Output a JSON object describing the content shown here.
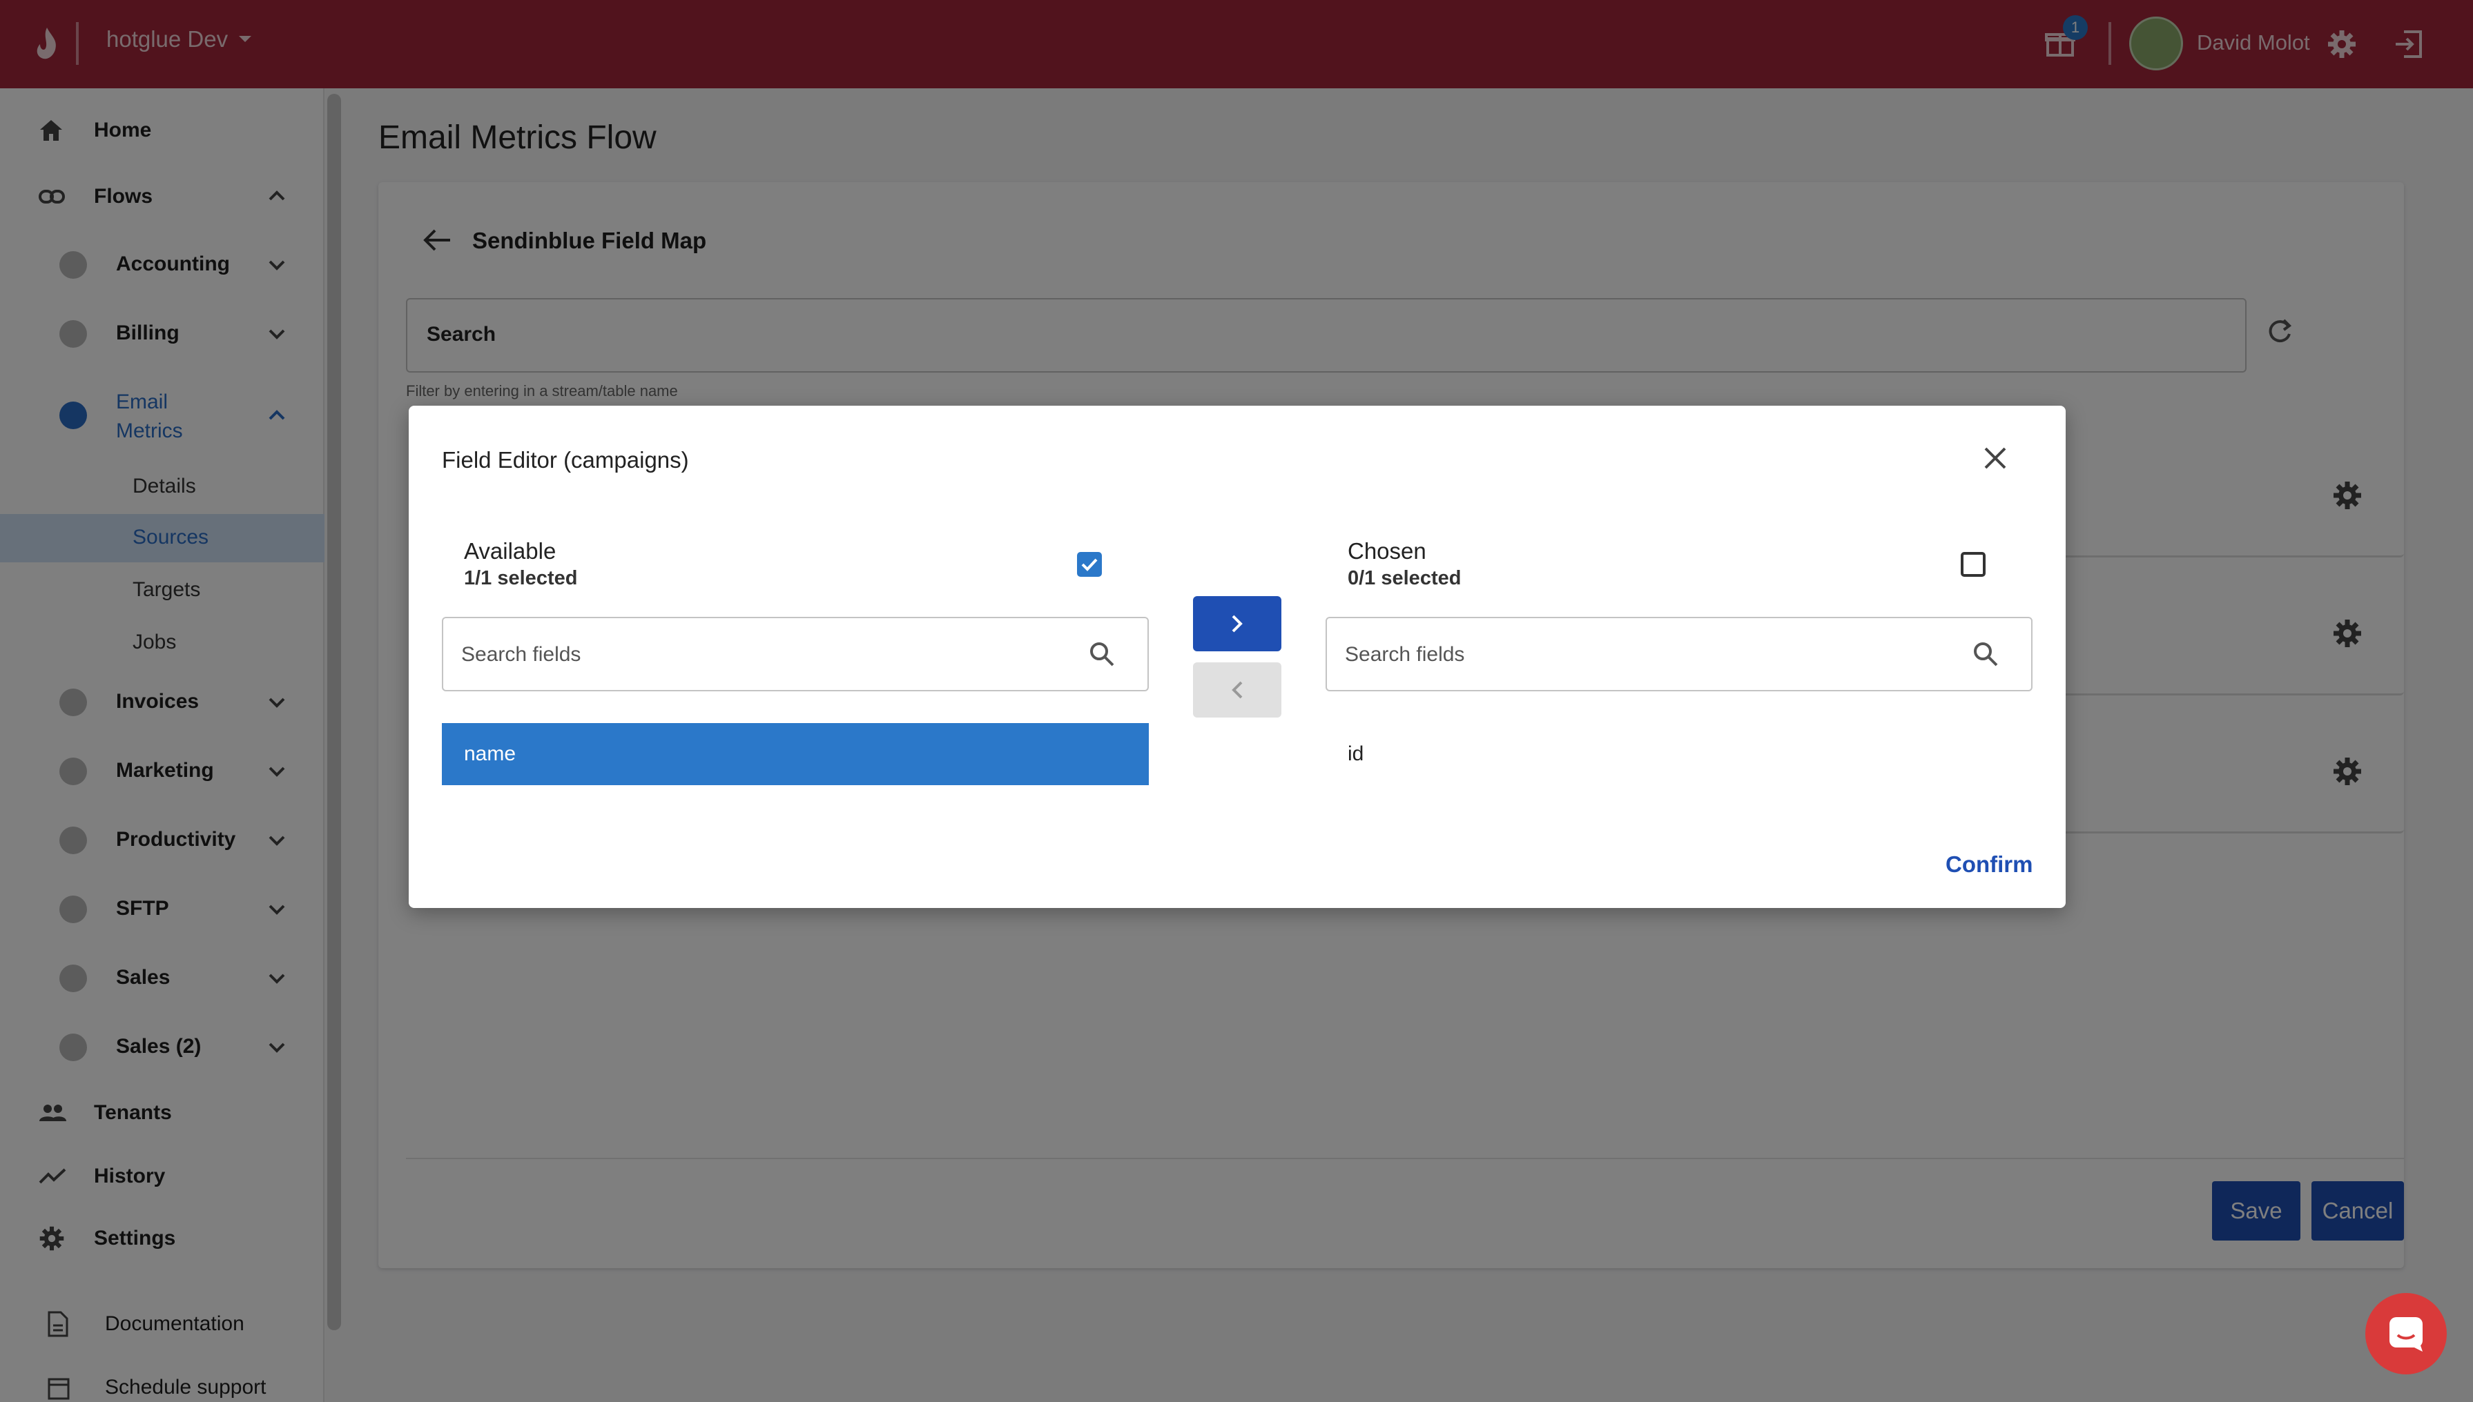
{
  "topbar": {
    "org_name": "hotglue Dev",
    "notification_count": "1",
    "user_name": "David Molot"
  },
  "sidebar": {
    "home": "Home",
    "flows": "Flows",
    "flow_items": [
      {
        "label": "Accounting"
      },
      {
        "label": "Billing"
      },
      {
        "label": "Email\nMetrics",
        "line1": "Email",
        "line2": "Metrics"
      },
      {
        "label": "Invoices"
      },
      {
        "label": "Marketing"
      },
      {
        "label": "Productivity"
      },
      {
        "label": "SFTP"
      },
      {
        "label": "Sales"
      },
      {
        "label": "Sales (2)"
      }
    ],
    "email_sub": [
      "Details",
      "Sources",
      "Targets",
      "Jobs"
    ],
    "tenants": "Tenants",
    "history": "History",
    "settings": "Settings",
    "documentation": "Documentation",
    "schedule_support": "Schedule support"
  },
  "main": {
    "title": "Email Metrics Flow",
    "field_map_title": "Sendinblue Field Map",
    "search_label": "Search",
    "search_helper": "Filter by entering in a stream/table name",
    "save_label": "Save",
    "cancel_label": "Cancel"
  },
  "modal": {
    "title": "Field Editor (campaigns)",
    "available": {
      "heading": "Available",
      "selected_text": "1/1 selected",
      "search_placeholder": "Search fields",
      "items": [
        "name"
      ]
    },
    "chosen": {
      "heading": "Chosen",
      "selected_text": "0/1 selected",
      "search_placeholder": "Search fields",
      "items": [
        "id"
      ]
    },
    "confirm_label": "Confirm"
  }
}
